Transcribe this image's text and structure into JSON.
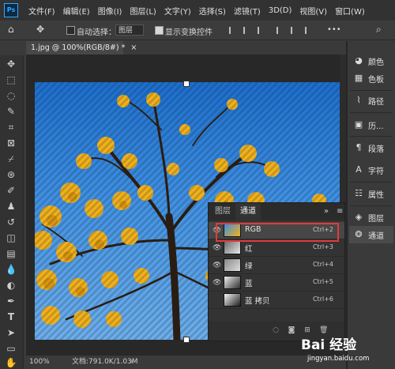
{
  "app": {
    "logo": "Ps"
  },
  "menu": [
    "文件(F)",
    "编辑(E)",
    "图像(I)",
    "图层(L)",
    "文字(Y)",
    "选择(S)",
    "滤镜(T)",
    "3D(D)",
    "视图(V)",
    "窗口(W)"
  ],
  "options": {
    "auto_select_label": "自动选择：",
    "auto_select_value": "图层",
    "show_transform_label": "显示变换控件"
  },
  "document": {
    "tab_title": "1.jpg @ 100%(RGB/8#) *",
    "zoom": "100%",
    "doc_info": "文档:791.0K/1.03M"
  },
  "dock": [
    {
      "label": "颜色",
      "icon": "palette-icon"
    },
    {
      "label": "色板",
      "icon": "swatches-icon"
    },
    {
      "label": "路径",
      "icon": "paths-icon"
    },
    {
      "label": "历...",
      "icon": "history-icon"
    },
    {
      "label": "段落",
      "icon": "paragraph-icon"
    },
    {
      "label": "字符",
      "icon": "character-icon"
    },
    {
      "label": "属性",
      "icon": "properties-icon"
    },
    {
      "label": "图层",
      "icon": "layers-icon"
    },
    {
      "label": "通道",
      "icon": "channels-icon"
    }
  ],
  "channels_panel": {
    "tabs": [
      "图层",
      "通道"
    ],
    "menu_glyph": "»",
    "channels": [
      {
        "name": "RGB",
        "shortcut": "Ctrl+2",
        "visible": true,
        "highlighted": true
      },
      {
        "name": "红",
        "shortcut": "Ctrl+3",
        "visible": true
      },
      {
        "name": "绿",
        "shortcut": "Ctrl+4",
        "visible": true
      },
      {
        "name": "蓝",
        "shortcut": "Ctrl+5",
        "visible": true
      },
      {
        "name": "蓝 拷贝",
        "shortcut": "Ctrl+6",
        "visible": false
      }
    ]
  },
  "watermark": {
    "main": "Bai 经验",
    "sub": "jingyan.baidu.com"
  },
  "colors": {
    "highlight": "#e23a3a",
    "accent": "#31a8ff",
    "flower": "#f2b21c"
  }
}
